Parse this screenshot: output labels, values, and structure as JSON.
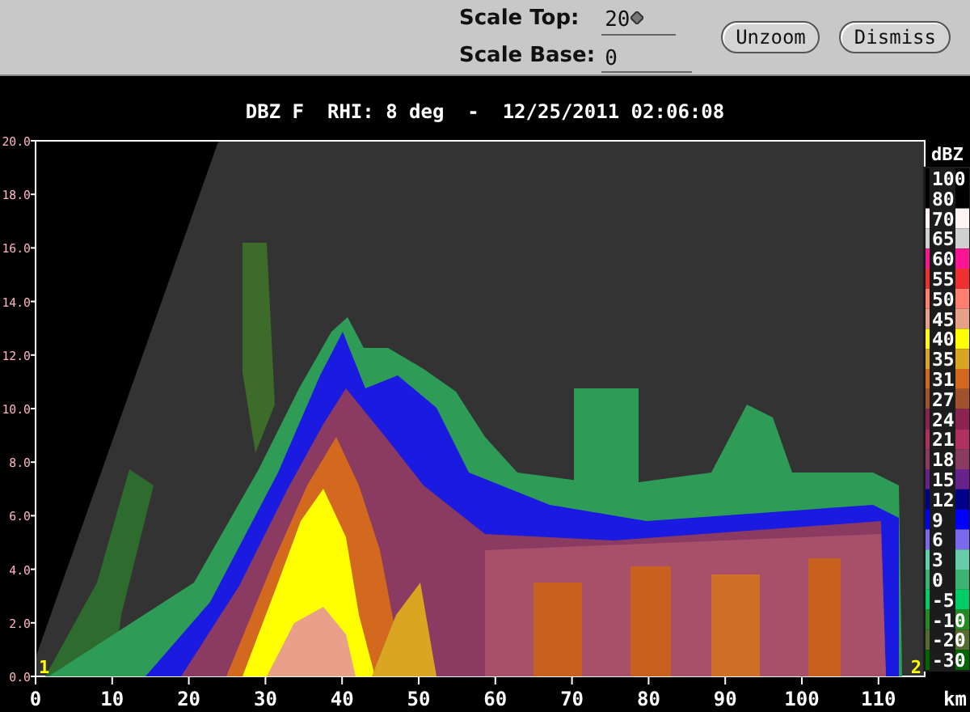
{
  "toolbar": {
    "fields": [
      {
        "label": "Scale Top:",
        "value": "20"
      },
      {
        "label": "Scale Base:",
        "value": "0"
      }
    ],
    "buttons": [
      "Unzoom",
      "Dismiss"
    ]
  },
  "plot": {
    "title": "DBZ F  RHI: 8 deg  -  12/25/2011 02:06:08",
    "y_axis_labels": [
      "20.0",
      "18.0",
      "16.0",
      "14.0",
      "12.0",
      "10.0",
      "8.0",
      "6.0",
      "4.0",
      "2.0",
      "0.0"
    ],
    "x_axis_labels": [
      "0",
      "10",
      "20",
      "30",
      "40",
      "50",
      "60",
      "70",
      "80",
      "90",
      "100",
      "110"
    ],
    "x_unit": "km",
    "corner_marks": [
      "1",
      "2"
    ],
    "legend": {
      "unit": "dBZ",
      "entries": [
        {
          "label": "100",
          "color": "#000000"
        },
        {
          "label": "80",
          "color": "#000000"
        },
        {
          "label": "70",
          "color": "#fff4f4"
        },
        {
          "label": "65",
          "color": "#d0d0d0"
        },
        {
          "label": "60",
          "color": "#ff1493"
        },
        {
          "label": "55",
          "color": "#ee3030"
        },
        {
          "label": "50",
          "color": "#ff8070"
        },
        {
          "label": "45",
          "color": "#e8a088"
        },
        {
          "label": "40",
          "color": "#ffff00"
        },
        {
          "label": "35",
          "color": "#daa520"
        },
        {
          "label": "31",
          "color": "#d2691e"
        },
        {
          "label": "27",
          "color": "#a0522d"
        },
        {
          "label": "24",
          "color": "#8b2252"
        },
        {
          "label": "21",
          "color": "#b03060"
        },
        {
          "label": "18",
          "color": "#8b3a62"
        },
        {
          "label": "15",
          "color": "#68228b"
        },
        {
          "label": "12",
          "color": "#00008b"
        },
        {
          "label": "9",
          "color": "#0000ff"
        },
        {
          "label": "6",
          "color": "#7b68ee"
        },
        {
          "label": "3",
          "color": "#66cdaa"
        },
        {
          "label": "0",
          "color": "#3cb371"
        },
        {
          "label": "-5",
          "color": "#00cd66"
        },
        {
          "label": "-10",
          "color": "#228b22"
        },
        {
          "label": "-20",
          "color": "#556b2f"
        },
        {
          "label": "-30",
          "color": "#006400"
        }
      ]
    }
  }
}
